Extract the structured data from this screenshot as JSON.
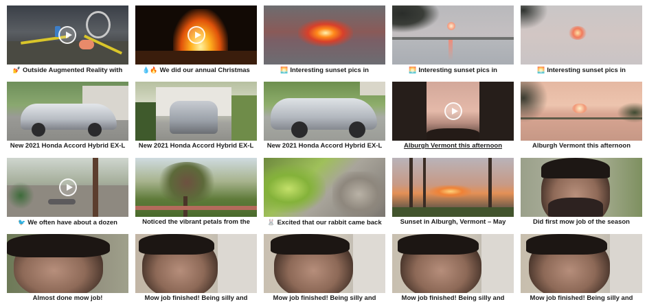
{
  "tiles": [
    {
      "caption": "Outside Augmented Reality with",
      "emoji": "💅"
    },
    {
      "caption": "We did our annual Christmas",
      "emoji": "💧🔥"
    },
    {
      "caption": "Interesting sunset pics in",
      "emoji": "🌅"
    },
    {
      "caption": "Interesting sunset pics in",
      "emoji": "🌅"
    },
    {
      "caption": "Interesting sunset pics in",
      "emoji": "🌅"
    },
    {
      "caption": "New 2021 Honda Accord Hybrid EX-L",
      "emoji": ""
    },
    {
      "caption": "New 2021 Honda Accord Hybrid EX-L",
      "emoji": ""
    },
    {
      "caption": "New 2021 Honda Accord Hybrid EX-L",
      "emoji": ""
    },
    {
      "caption": "Alburgh Vermont this afternoon",
      "emoji": ""
    },
    {
      "caption": "Alburgh Vermont this afternoon",
      "emoji": ""
    },
    {
      "caption": "We often have about a dozen",
      "emoji": "🐦"
    },
    {
      "caption": "Noticed the vibrant petals from the",
      "emoji": ""
    },
    {
      "caption": "Excited that our rabbit came back",
      "emoji": "🐰"
    },
    {
      "caption": "Sunset in Alburgh, Vermont – May",
      "emoji": ""
    },
    {
      "caption": "Did first mow job of the season",
      "emoji": ""
    },
    {
      "caption": "Almost done mow job!",
      "emoji": ""
    },
    {
      "caption": "Mow job finished! Being silly and",
      "emoji": ""
    },
    {
      "caption": "Mow job finished! Being silly and",
      "emoji": ""
    },
    {
      "caption": "Mow job finished! Being silly and",
      "emoji": ""
    },
    {
      "caption": "Mow job finished! Being silly and",
      "emoji": ""
    }
  ]
}
